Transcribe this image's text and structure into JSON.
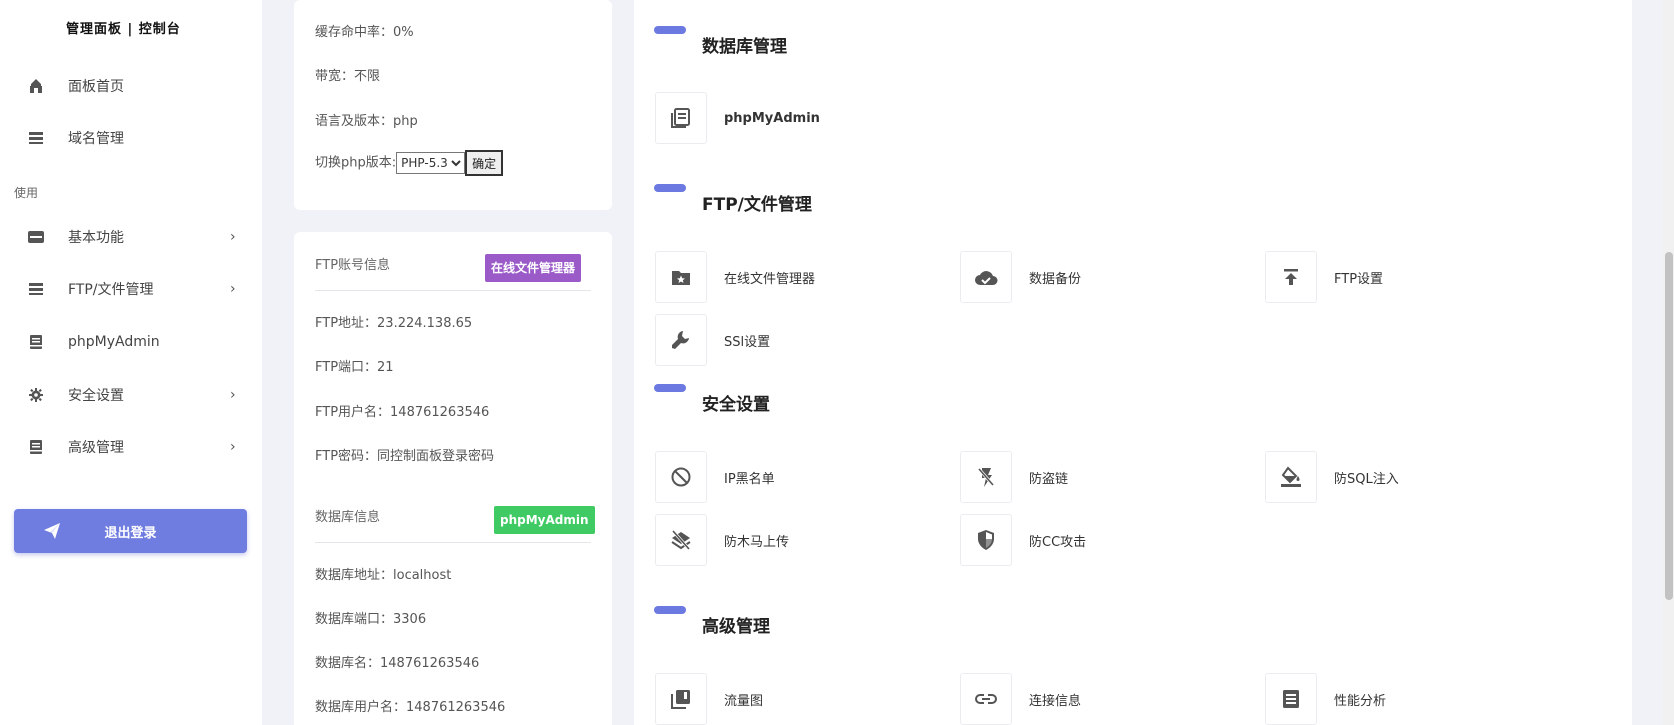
{
  "sidebar": {
    "brand": "管理面板 | 控制台",
    "top_items": [
      {
        "label": "面板首页",
        "icon": "home-icon"
      },
      {
        "label": "域名管理",
        "icon": "server-icon"
      }
    ],
    "section_label": "使用",
    "items": [
      {
        "label": "基本功能",
        "icon": "inbox-icon",
        "has_submenu": true
      },
      {
        "label": "FTP/文件管理",
        "icon": "server-icon",
        "has_submenu": true
      },
      {
        "label": "phpMyAdmin",
        "icon": "book-icon",
        "has_submenu": false
      },
      {
        "label": "安全设置",
        "icon": "gear-icon",
        "has_submenu": true
      },
      {
        "label": "高级管理",
        "icon": "book-icon",
        "has_submenu": true
      }
    ],
    "chevron": "›",
    "logout_label": "退出登录"
  },
  "site_card": {
    "cache_hit": "缓存命中率：0%",
    "bandwidth": "带宽：不限",
    "language": "语言及版本：php",
    "switch_label": "切换php版本:",
    "php_options": [
      "PHP-5.3"
    ],
    "confirm_label": "确定"
  },
  "ftp_card": {
    "header": "FTP账号信息",
    "file_manager_tag": "在线文件管理器",
    "address": "FTP地址：23.224.138.65",
    "port": "FTP端口：21",
    "username": "FTP用户名：148761263546",
    "password": "FTP密码：同控制面板登录密码",
    "db_header": "数据库信息",
    "phpmyadmin_tag": "phpMyAdmin",
    "db_address": "数据库地址：localhost",
    "db_port": "数据库端口：3306",
    "db_name": "数据库名：148761263546",
    "db_user": "数据库用户名：148761263546"
  },
  "panel": {
    "sections": [
      {
        "title": "数据库管理",
        "items": [
          {
            "label": "phpMyAdmin",
            "icon": "document-icon"
          }
        ]
      },
      {
        "title": "FTP/文件管理",
        "items": [
          {
            "label": "在线文件管理器",
            "icon": "folder-star-icon"
          },
          {
            "label": "数据备份",
            "icon": "cloud-icon"
          },
          {
            "label": "FTP设置",
            "icon": "upload-icon"
          },
          {
            "label": "SSl设置",
            "icon": "wrench-icon"
          }
        ]
      },
      {
        "title": "安全设置",
        "items": [
          {
            "label": "IP黑名单",
            "icon": "block-icon"
          },
          {
            "label": "防盗链",
            "icon": "flash-off-icon"
          },
          {
            "label": "防SQL注入",
            "icon": "paint-bucket-icon"
          },
          {
            "label": "防木马上传",
            "icon": "layers-off-icon"
          },
          {
            "label": "防CC攻击",
            "icon": "shield-icon"
          }
        ]
      },
      {
        "title": "高级管理",
        "items": [
          {
            "label": "流量图",
            "icon": "library-icon"
          },
          {
            "label": "连接信息",
            "icon": "link-icon"
          },
          {
            "label": "性能分析",
            "icon": "list-document-icon"
          }
        ]
      }
    ]
  },
  "colors": {
    "accent": "#6c79e0",
    "logout": "#6f7ce0",
    "tag_purple": "#9a5ac8",
    "tag_green": "#3fca64",
    "background": "#f1f2f7"
  }
}
